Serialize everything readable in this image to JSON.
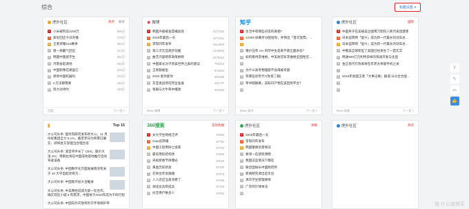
{
  "section_title": "综合",
  "settings_label": "有趣设置",
  "cards_top": [
    {
      "source": "虎扑社区",
      "logo_color": "#f2a100",
      "tabs": [
        "热点",
        "知乎"
      ],
      "rows": [
        {
          "t": "小米被列前1200万",
          "v": "806万"
        },
        {
          "t": "索尼回应今日开播",
          "v": "478万"
        },
        {
          "t": "王者荣耀S18赛季",
          "v": "392万"
        },
        {
          "t": "唐一顿霸气回应",
          "v": "314万"
        },
        {
          "t": "韩国中国留学生",
          "v": "281万"
        },
        {
          "t": "河南省起源地",
          "v": "264万"
        },
        {
          "t": "中国影像在哪里亿",
          "v": "236万"
        },
        {
          "t": "感到中国机器吗",
          "v": "210万"
        },
        {
          "t": "C方法都需要",
          "v": "182万"
        },
        {
          "t": "努力对待时",
          "v": "160万"
        }
      ],
      "footer_source": "百度",
      "next": "下一页 >"
    },
    {
      "source": "微博",
      "logo_color": "#e6162d",
      "tabs": [],
      "rows": [
        {
          "t": "韩国声援被查首播途径",
          "v": "3137325"
        },
        {
          "t": "2019年最后一天",
          "v": "2271161"
        },
        {
          "t": "李现同年发布",
          "v": "1514600"
        },
        {
          "t": "第三次元旦跑步动图",
          "v": "1232563"
        },
        {
          "t": "曲艺内容明年政策换称",
          "v": "1078412"
        },
        {
          "t": "中国家长对子弟拿世界之类的建议",
          "v": "794322"
        },
        {
          "t": "王者鹅被鱼",
          "v": "676402"
        },
        {
          "t": "2020 爱你爱你",
          "v": "481496"
        },
        {
          "t": "东亚奥运场馆完全准备",
          "v": "451737"
        },
        {
          "t": "张翰与大牛率中播放",
          "v": "451092"
        }
      ],
      "footer_source": "Rose 微博",
      "next": "下一页 >"
    },
    {
      "source": "知乎",
      "logo_color": "#0084ff",
      "tabs": [],
      "rows": [
        {
          "t": "生活中有哪些日常的真相?",
          "v": ""
        },
        {
          "t": "12306 屏幕步分配给你，并预出「首次放票」被标也得，今后如何合理",
          "v": ""
        },
        {
          "t": "",
          "v": ""
        },
        {
          "t": "猪价在有 1% 的阿中生是来不愿正面表答？",
          "v": ""
        },
        {
          "t": "如何看待李维格、中美防冠军李维格全国性冠军性，情况何话应该设计过中国...",
          "v": ""
        },
        {
          "t": "",
          "v": ""
        },
        {
          "t": "为什么高考物理题不会再被考题",
          "v": ""
        },
        {
          "t": "有哪些优年代?(你第二辑)",
          "v": ""
        },
        {
          "t": "宰书铭解散，该知识产物应该回到平台？",
          "v": ""
        },
        {
          "t": "",
          "v": ""
        }
      ],
      "footer_source": "Rose 知乎",
      "next": "下一页 >"
    },
    {
      "source": "虎扑社区",
      "logo_color": "#2a84d6",
      "tabs": [
        "国际"
      ],
      "rows": [
        {
          "t": "中国男子在美被美企图用刀割伤人民代表团遇害",
          "v": ""
        },
        {
          "t": "日本运转网「复兴」成为新一代最长的动车总统前1100元",
          "v": ""
        },
        {
          "t": "日本运转网「复兴」成为新一代最长的动车总统前1100元",
          "v": ""
        },
        {
          "t": "中俄美全球新型了美国已经发生了一首实实",
          "v": ""
        },
        {
          "t": "韩通900亿元利特多样的快速开发与化后",
          "v": ""
        },
        {
          "t": "金正恩代行改革将在年老太奉献手机之关",
          "v": ""
        },
        {
          "t": "",
          "v": ""
        },
        {
          "t": "2019年各国王者「大事记要」报道:分分合合复案中",
          "v": ""
        },
        {
          "t": "",
          "v": ""
        },
        {
          "t": "",
          "v": ""
        }
      ],
      "footer_source": "Rose 网易",
      "next": "下一页 >"
    }
  ],
  "cards_bottom": [
    {
      "source": "参考消息",
      "header_right": "Top 15",
      "items": [
        "大公司头条: 国务院研究发布新文公，11 月份好集团全力 5.1%，截至年日为积累已确实、即将各方案理当合理合适",
        "大公司头条: 波音吊手长了 CEO，股价大涨 3%；特斯拉将在中国成地基地推行自动驾驶设备",
        "大公司头条: 中国数字化方面发展情况有关于 10 大学自起项目方...",
        "大公司头条: 中国家外加大合推进",
        "大公司头条: 中美两经说成为第一轮合作，确实现在小城 6 有需求，中国将于2020年成为千四行程",
        "大公司头条: 中国向外开放有利于环境保护带"
      ],
      "footer_source": "",
      "next": "下一页 >"
    },
    {
      "source": "360搜索",
      "header_right": "实时热搜",
      "rows": [
        {
          "t": "女大学生网络泛评",
          "v": "97890"
        },
        {
          "t": "Giao前转播",
          "v": "97791"
        },
        {
          "t": "中国工程用除士提家",
          "v": "97763"
        },
        {
          "t": "最常用的结构改",
          "v": "97666"
        },
        {
          "t": "央视新春节目曝光",
          "v": "97549"
        },
        {
          "t": "黄金历史新高",
          "v": "97436"
        },
        {
          "t": "芒果台年会跟播",
          "v": "97376"
        },
        {
          "t": "人人店应当发消费了",
          "v": "97286"
        },
        {
          "t": "湖北女兵练成兵",
          "v": "97103"
        },
        {
          "t": "抖音用户数多少",
          "v": "97091"
        }
      ],
      "footer_source": "",
      "next": "下一页 >"
    },
    {
      "source": "虎扑社区",
      "header_right": "热榜",
      "rows": [
        {
          "t": "2019年最后一天",
          "v": ""
        },
        {
          "t": "李现同年发布",
          "v": ""
        },
        {
          "t": "韩国警察伤害情况",
          "v": ""
        },
        {
          "t": "要领一在建筑博物",
          "v": ""
        },
        {
          "t": "我国这些情况下都在",
          "v": ""
        },
        {
          "t": "联合国如长中国政府所",
          "v": ""
        },
        {
          "t": "新闻研究调出是文化",
          "v": ""
        },
        {
          "t": "清华学生管理要情",
          "v": ""
        },
        {
          "t": "广东阿计球本法",
          "v": ""
        },
        {
          "t": "",
          "v": ""
        }
      ],
      "footer_source": "",
      "next": "下一页 >"
    },
    {
      "source": "虎扑社区",
      "header_right": "热点",
      "rows": [],
      "footer_source": "",
      "next": ""
    }
  ],
  "sidebar": [
    {
      "icon": "wishlist-icon",
      "glyph": "Y"
    },
    {
      "icon": "edit-icon",
      "glyph": "✎"
    },
    {
      "icon": "font-size-icon",
      "glyph": "AA"
    },
    {
      "icon": "thumb-up-icon",
      "glyph": "👍"
    }
  ],
  "watermark": "值 什么值得买"
}
